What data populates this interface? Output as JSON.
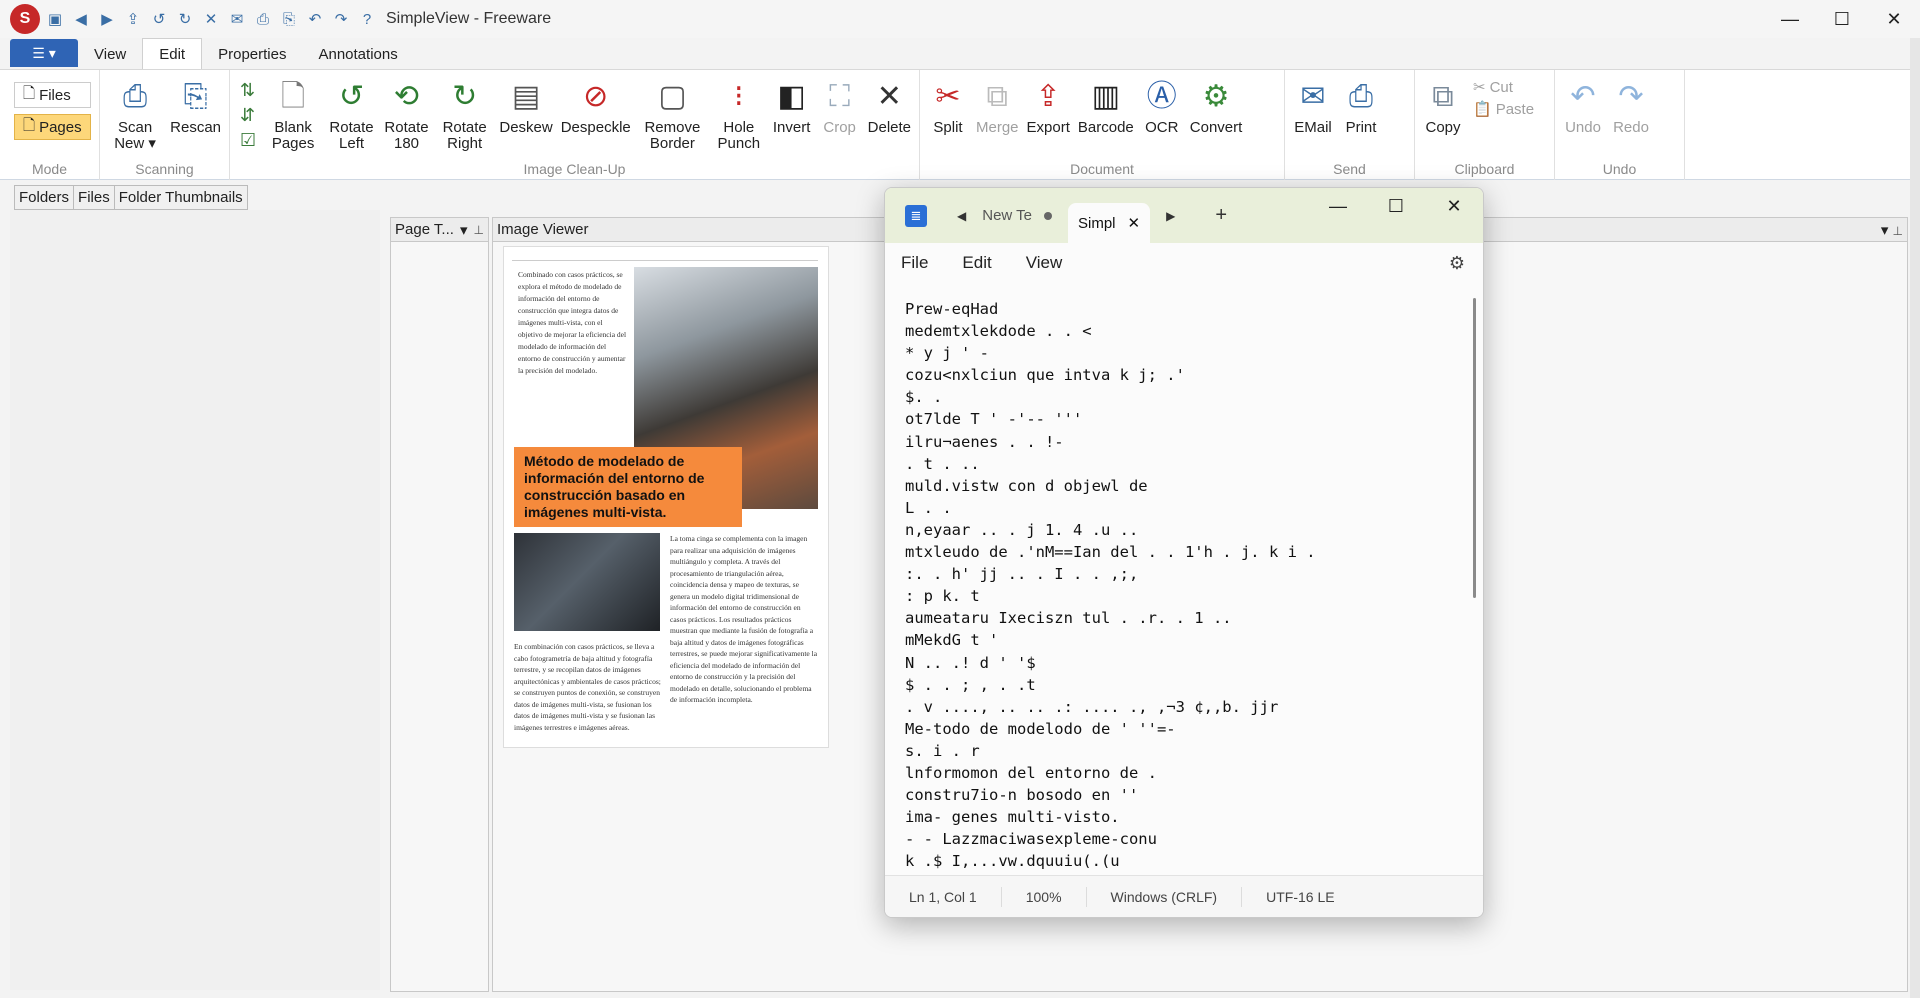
{
  "window": {
    "title": "SimpleView - Freeware",
    "controls": [
      "—",
      "☐",
      "✕"
    ]
  },
  "ribbon_tabs": {
    "file": "☰ ▾",
    "view": "View",
    "edit": "Edit",
    "properties": "Properties",
    "annotations": "Annotations"
  },
  "mode": {
    "files": "Files",
    "pages": "Pages",
    "label": "Mode"
  },
  "scanning": {
    "scan_new": "Scan New ▾",
    "rescan": "Rescan",
    "label": "Scanning"
  },
  "cleanup": {
    "blank_pages": "Blank Pages",
    "rotate_left": "Rotate Left",
    "rotate_180": "Rotate 180",
    "rotate_right": "Rotate Right",
    "deskew": "Deskew",
    "despeckle": "Despeckle",
    "remove_border": "Remove Border",
    "hole_punch": "Hole Punch",
    "invert": "Invert",
    "crop": "Crop",
    "delete": "Delete",
    "label": "Image Clean-Up"
  },
  "document": {
    "split": "Split",
    "merge": "Merge",
    "export": "Export",
    "barcode": "Barcode",
    "ocr": "OCR",
    "convert": "Convert",
    "label": "Document"
  },
  "send": {
    "email": "EMail",
    "print": "Print",
    "label": "Send"
  },
  "clipboard": {
    "copy": "Copy",
    "cut": "Cut",
    "paste": "Paste",
    "label": "Clipboard"
  },
  "undo": {
    "undo": "Undo",
    "redo": "Redo",
    "label": "Undo"
  },
  "left_tabs": {
    "folders": "Folders",
    "files": "Files",
    "thumbs": "Folder Thumbnails"
  },
  "panels": {
    "pagelist": "Page T...",
    "viewer": "Image Viewer"
  },
  "doc": {
    "col1": "Combinado con casos prácticos, se explora el método de modelado de información del entorno de construcción que integra datos de imágenes multi-vista, con el objetivo de mejorar la eficiencia del modelado de información del entorno de construcción y aumentar la precisión del modelado.",
    "heading": "Método de modelado de información del entorno de construcción basado en imágenes multi-vista.",
    "col2": "La toma cinga se complementa con la imagen para realizar una adquisición de imágenes multiángulo y completa. A través del procesamiento de triangulación aérea, coincidencia densa y mapeo de texturas, se genera un modelo digital tridimensional de información del entorno de construcción en casos prácticos. Los resultados prácticos muestran que mediante la fusión de fotografía a baja altitud y datos de imágenes fotográficas terrestres, se puede mejorar significativamente la eficiencia del modelado de información del entorno de construcción y la precisión del modelado en detalle, solucionando el problema de información incompleta.",
    "col3": "En combinación con casos prácticos, se lleva a cabo fotogrametría de baja altitud y fotografía terrestre, y se recopilan datos de imágenes arquitectónicas y ambientales de casos prácticos; se construyen puntos de conexión, se construyen datos de imágenes multi-vista, se fusionan los datos de imágenes multi-vista y se fusionan las imágenes terrestres e imágenes aéreas."
  },
  "notepad": {
    "tab_inactive": "New Te",
    "tab_active": "Simpl",
    "menu": {
      "file": "File",
      "edit": "Edit",
      "view": "View"
    },
    "text": "Prew-eqHad\nmedemtxlekdode . . <\n* y j ' -\ncozu<nxlciun que intva k j; .'\n$. .\not7lde T ' -'-- '''\nilru¬aenes . . !-\n. t . ..\nmuld.vistw con d objewl de\nL . .\nn,eyaar .. . j 1. 4 .u ..\nmtxleudo de .'nM==Ian del . . 1'h . j. k i .\n:. . h' jj .. . I . . ,;,\n: p k. t\naumeataru Ixeciszn tul . .r. . 1 ..\nmMekdG t '\nN .. .! d ' '$\n$ . . ; , . .t\n. v ...., .. .. .: .... ., ,¬3 ¢,,b. jjr\nMe-todo de modelodo de ' ''=-\ns. i . r\nlnformomon del entorno de .\nconstru7io-n bosodo en ''\nima- genes multi-visto.\n- - Lazzmaciwasexpleme-conu\nk .$ I,...vw.dquuiu(.(u",
    "status": {
      "position": "Ln 1, Col 1",
      "zoom": "100%",
      "eol": "Windows (CRLF)",
      "encoding": "UTF-16 LE"
    }
  }
}
